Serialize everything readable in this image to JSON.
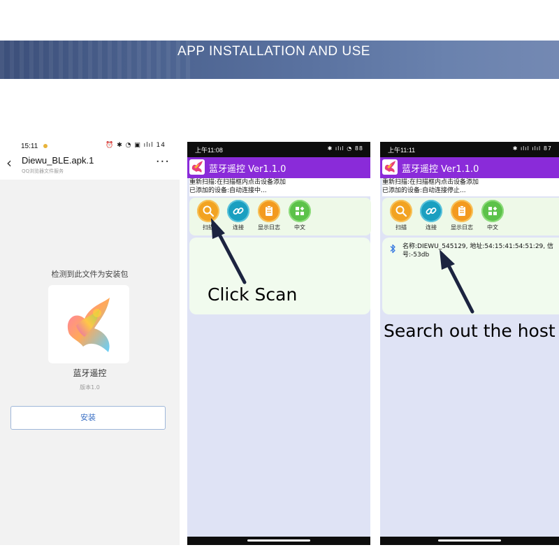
{
  "banner": {
    "title": "APP INSTALLATION AND USE"
  },
  "installer": {
    "time": "15:11",
    "status_icons": "⏰ ✱ ◔ ▣ ılıl 14",
    "filename": "Diewu_BLE.apk.1",
    "subtitle": "QQ浏览器文件服务",
    "more": "···",
    "detected_text": "检测到此文件为安装包",
    "app_name": "蓝牙遥控",
    "version": "版本1.0",
    "install_button": "安装",
    "icon_name": "app-logo-icon"
  },
  "phone_scan": {
    "time": "上午11:08",
    "status_icons": "✱ ılıl ◔ 88",
    "app_title": "蓝牙遥控 Ver1.1.0",
    "info_lines": [
      "重新扫描:在扫描框内点击设备添加",
      "已添加的设备:自动连接中..."
    ],
    "toolbar": [
      {
        "label": "扫描",
        "icon": "search-icon",
        "color": "#f2a322"
      },
      {
        "label": "连接",
        "icon": "link-icon",
        "color": "#1a9fc0"
      },
      {
        "label": "显示日志",
        "icon": "clipboard-icon",
        "color": "#f39a1f"
      },
      {
        "label": "中文",
        "icon": "grid-icon",
        "color": "#5cc24a"
      }
    ],
    "callout": "Click Scan"
  },
  "phone_host": {
    "time": "上午11:11",
    "status_icons": "✱ ılıl ılıl 87",
    "app_title": "蓝牙遥控 Ver1.1.0",
    "info_lines": [
      "重新扫描:在扫描框内点击设备添加",
      "已添加的设备:自动连接停止..."
    ],
    "toolbar": [
      {
        "label": "扫描",
        "icon": "search-icon",
        "color": "#f2a322"
      },
      {
        "label": "连接",
        "icon": "link-icon",
        "color": "#1a9fc0"
      },
      {
        "label": "显示日志",
        "icon": "clipboard-icon",
        "color": "#f39a1f"
      },
      {
        "label": "中文",
        "icon": "grid-icon",
        "color": "#5cc24a"
      }
    ],
    "device": {
      "line1": "名称:DIEWU_545129, 地址:54:15:41:54:51:29, 信",
      "line2": "号:-53db"
    },
    "callout": "Search out the host"
  },
  "colors": {
    "title_bar": "#8a2bd9",
    "content_bg": "#dfe3f5",
    "card_bg": "#eef9e8",
    "install_text": "#3a6fc4",
    "banner": "#4d6491"
  }
}
